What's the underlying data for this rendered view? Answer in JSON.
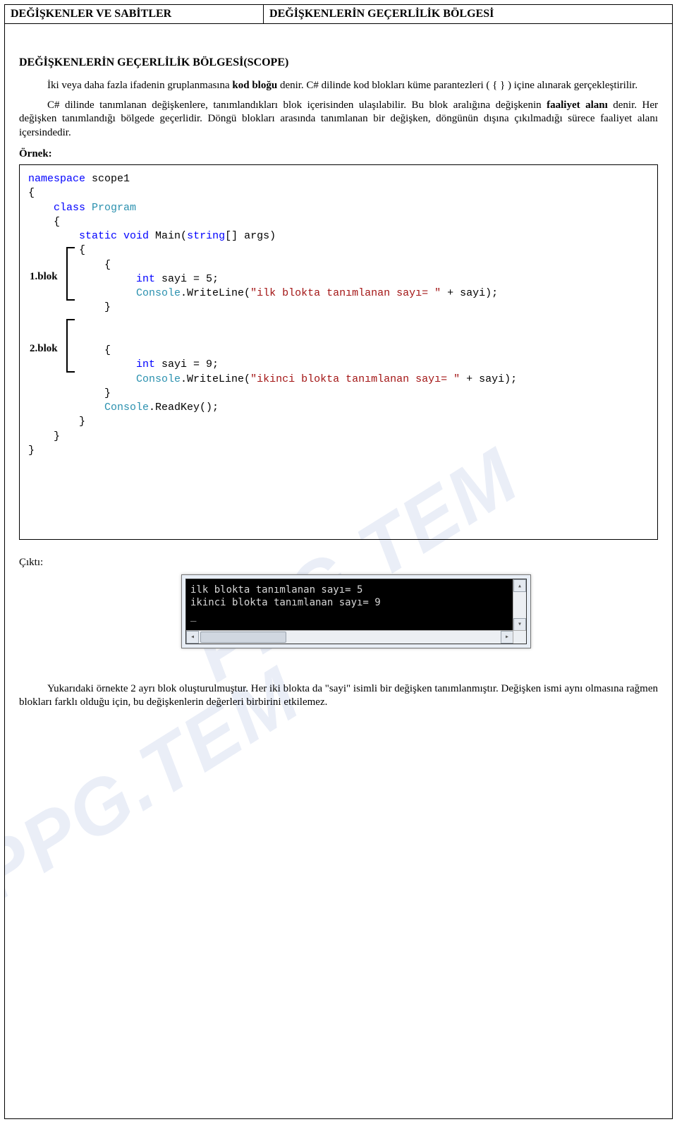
{
  "header": {
    "left": "DEĞİŞKENLER VE SABİTLER",
    "right": "DEĞİŞKENLERİN GEÇERLİLİK BÖLGESİ"
  },
  "section_title": "DEĞİŞKENLERİN GEÇERLİLİK BÖLGESİ(SCOPE)",
  "para1_a": "İki veya daha fazla ifadenin gruplanmasına ",
  "para1_b": "kod bloğu",
  "para1_c": " denir. C# dilinde kod blokları küme parantezleri ( { } ) içine alınarak gerçekleştirilir.",
  "para2_a": "C# dilinde tanımlanan değişkenlere, tanımlandıkları blok içerisinden ulaşılabilir. Bu blok aralığına değişkenin ",
  "para2_b": "faaliyet alanı",
  "para2_c": " denir. Her değişken tanımlandığı bölgede geçerlidir. Döngü blokları arasında tanımlanan bir değişken, döngünün dışına çıkılmadığı sürece faaliyet alanı içersindedir.",
  "ornek_label": "Örnek:",
  "code": {
    "namespace_kw": "namespace",
    "ns_name": " scope1",
    "ob": "{",
    "cb": "}",
    "class_kw": "class",
    "class_name": " Program",
    "static_kw": "static",
    "void_kw": " void",
    "main_sig_a": " Main(",
    "string_kw": "string",
    "main_sig_b": "[] args)",
    "int_kw": "int",
    "sayi5": " sayi = 5;",
    "console_cls": "Console",
    "wl1_a": ".WriteLine(",
    "str1": "\"ilk blokta tanımlanan sayı= \"",
    "wl1_b": " + sayi);",
    "sayi9": " sayi = 9;",
    "str2": "\"ikinci blokta tanımlanan sayı= \"",
    "rk": ".ReadKey();",
    "blok1_label": "1.blok",
    "blok2_label": "2.blok"
  },
  "cikti_label": "Çıktı:",
  "console": {
    "line1": "ilk blokta tanımlanan sayı= 5",
    "line2": "ikinci blokta tanımlanan sayı= 9",
    "cursor": "_"
  },
  "para3": "Yukarıdaki örnekte 2 ayrı blok oluşturulmuştur. Her iki blokta da \"sayi\" isimli bir değişken tanımlanmıştır. Değişken ismi aynı olmasına rağmen blokları farklı olduğu için, bu değişkenlerin değerleri birbirini etkilemez.",
  "watermark": "PPG.TEM"
}
